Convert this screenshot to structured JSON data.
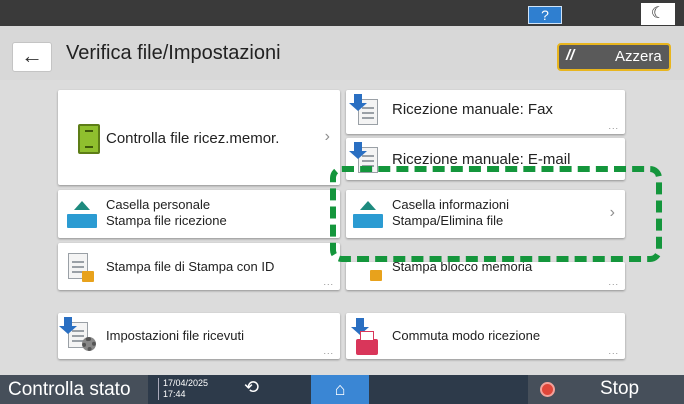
{
  "topbar": {
    "help_label": "?",
    "night_icon": "moon-icon"
  },
  "header": {
    "back_icon": "←",
    "title": "Verifica file/Impostazioni",
    "reset_label": "Azzera",
    "reset_icon": "//"
  },
  "tiles": {
    "check_received": {
      "label": "Controlla file ricez.memor."
    },
    "manual_fax": {
      "label": "Ricezione manuale: Fax"
    },
    "manual_email": {
      "label": "Ricezione manuale: E-mail"
    },
    "personal_box": {
      "line1": "Casella personale",
      "line2": "Stampa file ricezione"
    },
    "info_box": {
      "line1": "Casella informazioni",
      "line2": "Stampa/Elimina file"
    },
    "print_id": {
      "label": "Stampa file di Stampa con ID"
    },
    "print_locked": {
      "label": "Stampa blocco memoria"
    },
    "received_settings": {
      "label": "Impostazioni file ricevuti"
    },
    "switch_mode": {
      "label": "Commuta modo ricezione"
    }
  },
  "common": {
    "dots": "...",
    "chevron": "›"
  },
  "bottombar": {
    "status_label": "Controlla stato",
    "date": "17/04/2025",
    "time": "17:44",
    "back_icon": "⟲",
    "home_icon": "⌂",
    "stop_label": "Stop"
  },
  "colors": {
    "highlight": "#14963c",
    "accent": "#e8b51e",
    "home": "#3a86d4"
  }
}
